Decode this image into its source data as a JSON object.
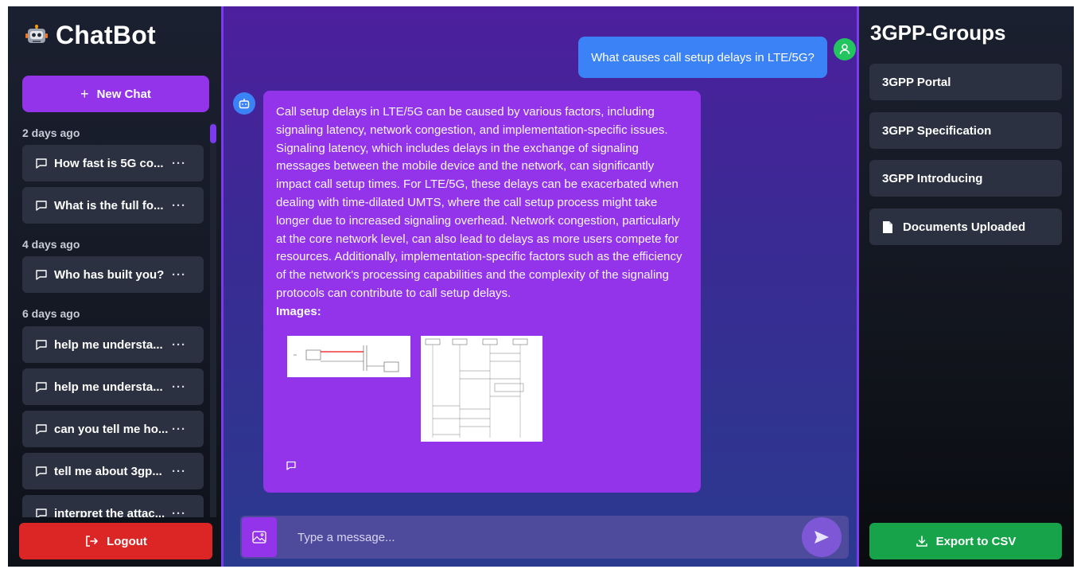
{
  "app": {
    "title": "ChatBot",
    "new_chat_label": "New Chat",
    "logout_label": "Logout"
  },
  "history": {
    "groups": [
      {
        "label": "2 days ago"
      },
      {
        "label": "4 days ago"
      },
      {
        "label": "6 days ago"
      }
    ],
    "items": [
      {
        "title": "How fast is 5G co...",
        "more": "···"
      },
      {
        "title": "What is the full fo...",
        "more": "···"
      },
      {
        "title": "Who has built you?",
        "more": "···"
      },
      {
        "title": "help me understa...",
        "more": "···"
      },
      {
        "title": "help me understa...",
        "more": "···"
      },
      {
        "title": "can you tell me ho...",
        "more": "···"
      },
      {
        "title": "tell me about 3gp...",
        "more": "···"
      },
      {
        "title": "interpret the attac...",
        "more": "···"
      }
    ]
  },
  "conversation": {
    "user_message": "What causes call setup delays in LTE/5G?",
    "bot_message": "Call setup delays in LTE/5G can be caused by various factors, including signaling latency, network congestion, and implementation-specific issues. Signaling latency, which includes delays in the exchange of signaling messages between the mobile device and the network, can significantly impact call setup times. For LTE/5G, these delays can be exacerbated when dealing with time-dilated UMTS, where the call setup process might take longer due to increased signaling overhead. Network congestion, particularly at the core network level, can also lead to delays as more users compete for resources. Additionally, implementation-specific factors such as the efficiency of the network's processing capabilities and the complexity of the signaling protocols can contribute to call setup delays.",
    "images_label": "Images:"
  },
  "composer": {
    "placeholder": "Type a message..."
  },
  "right_panel": {
    "title": "3GPP-Groups",
    "links": [
      {
        "label": "3GPP Portal"
      },
      {
        "label": "3GPP Specification"
      },
      {
        "label": "3GPP Introducing"
      },
      {
        "label": "Documents Uploaded",
        "icon": "file-icon"
      }
    ],
    "export_label": "Export to CSV"
  },
  "colors": {
    "accent_purple": "#9333ea",
    "user_bubble": "#3b82f6",
    "logout_red": "#dc2626",
    "export_green": "#16a34a"
  }
}
